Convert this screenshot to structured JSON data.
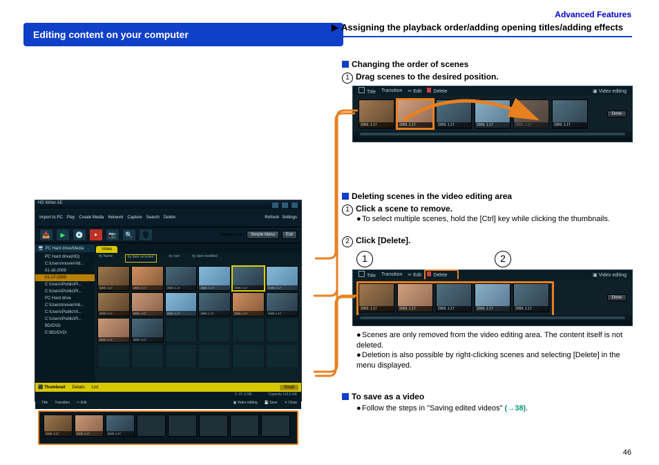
{
  "header": {
    "advanced_features": "Advanced Features"
  },
  "title_bar": {
    "editing_content": "Editing content on your computer"
  },
  "section": {
    "arrow": "▶",
    "title": "Assigning the playback order/adding opening titles/adding effects"
  },
  "sub_changing": {
    "heading": "Changing the order of scenes",
    "step1": "Drag scenes to the desired position."
  },
  "sub_deleting": {
    "heading": "Deleting scenes in the video editing area",
    "step1": "Click a scene to remove.",
    "bullet1": "To select multiple scenes, hold the [Ctrl] key while clicking the thumbnails.",
    "step2": "Click [Delete].",
    "bullet2": "Scenes are only removed from the video editing area. The content itself is not deleted.",
    "bullet3": "Deletion is also possible by right-clicking scenes and selecting [Delete] in the menu displayed."
  },
  "sub_save": {
    "heading": "To save as a video",
    "bullet": "Follow the steps in \"Saving edited videos\"",
    "link": "(→38)",
    "period": "."
  },
  "app": {
    "title": "HD Writer AE",
    "toolbar": {
      "import": "Import to PC",
      "play": "Play",
      "create": "Create Media",
      "network": "Network",
      "capture": "Capture",
      "search": "Search",
      "delete": "Delete",
      "refresh": "Refresh",
      "settings": "Settings",
      "opening": "Opening movie:",
      "simple_menu": "Simple Menu",
      "exit": "Exit"
    },
    "sidebar": {
      "head": "PC Hard drive/Media",
      "items": [
        "PC Hard drive(HD)",
        "C:\\Users\\movie\\Vid...",
        "01-16-2009",
        "01-17-2009",
        "C:\\Users\\Public\\Pi...",
        "C:\\Users\\Public\\Pi...",
        "PC Hard drive",
        "C:\\Users\\movie\\Vid...",
        "C:\\Users\\Public\\Vi...",
        "C:\\Users\\Public\\Pi...",
        "BD/DVD",
        "E:\\BD/DVD\\"
      ],
      "selected_index": 3
    },
    "tabs": {
      "video": "Video"
    },
    "sort": {
      "name": "by Name",
      "recorded": "by date recorded",
      "size": "by size",
      "modified": "by date modified"
    },
    "thumb_date": "2009. 1.17",
    "midbar": {
      "thumbnail": "Thumbnail",
      "details": "Details",
      "list": "List",
      "small": "Small"
    },
    "infobar": {
      "free": "C:  87.3 GB",
      "capacity": "Capacity  119.0 GB"
    },
    "editbar": {
      "title": "Title",
      "transition": "Transition",
      "edit": "Edit",
      "video_editing": "Video editing",
      "save": "Save",
      "close": "Close"
    }
  },
  "mini": {
    "title": "Title",
    "transition": "Transition",
    "edit": "Edit",
    "delete": "Delete",
    "video_editing": "Video editing",
    "done": "Done",
    "date": "2009. 1.17"
  },
  "page_number": "46"
}
